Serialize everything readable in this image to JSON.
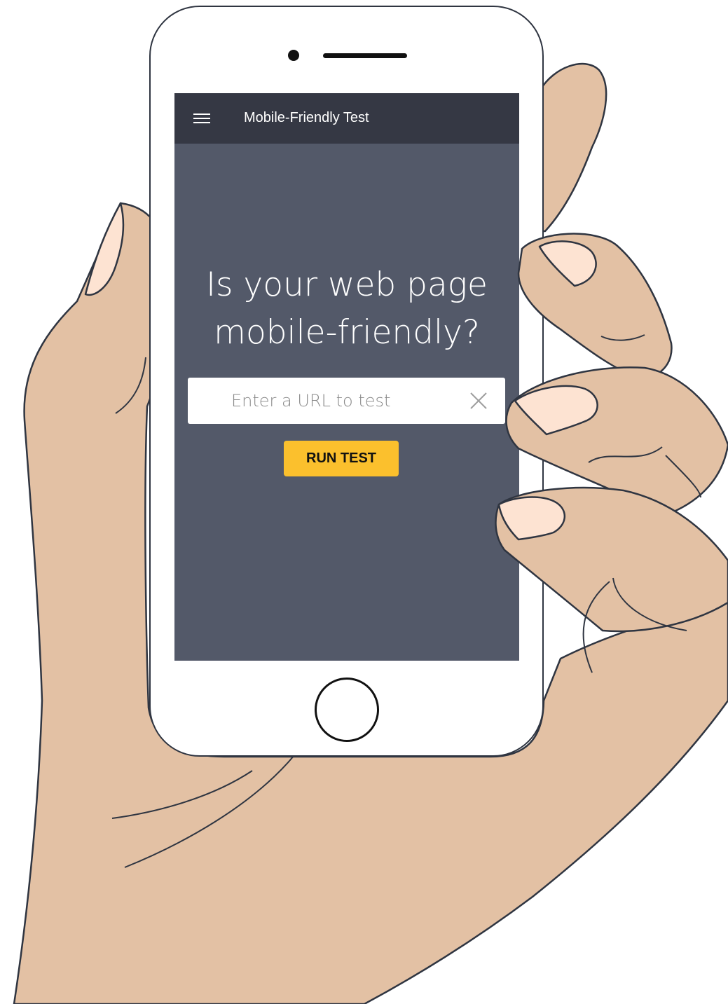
{
  "app": {
    "title": "Mobile-Friendly Test",
    "menu_icon": "hamburger-menu-icon"
  },
  "main": {
    "headline_line1": "Is your web page",
    "headline_line2": "mobile-friendly?",
    "url_input": {
      "placeholder": "Enter a URL to test",
      "value": "",
      "clear_icon": "close-icon"
    },
    "run_button_label": "RUN TEST"
  },
  "colors": {
    "screen_background": "#535969",
    "topbar_background": "#353844",
    "button_accent": "#fbc02d",
    "skin": "#e3c1a4",
    "fingernail": "#fde3d2",
    "outline": "#2f3541"
  }
}
